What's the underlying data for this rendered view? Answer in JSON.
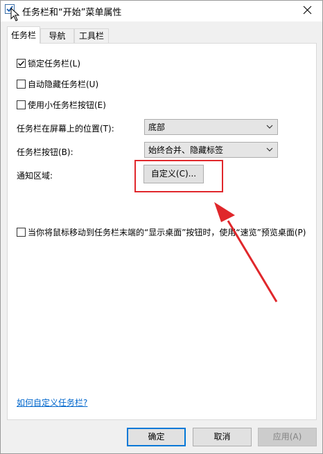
{
  "window": {
    "title": "任务栏和“开始”菜单属性"
  },
  "tabs": [
    {
      "label": "任务栏",
      "active": true
    },
    {
      "label": "导航",
      "active": false
    },
    {
      "label": "工具栏",
      "active": false
    }
  ],
  "options": {
    "lock_taskbar": {
      "label": "锁定任务栏(L)",
      "checked": true
    },
    "auto_hide": {
      "label": "自动隐藏任务栏(U)",
      "checked": false
    },
    "small_buttons": {
      "label": "使用小任务栏按钮(E)",
      "checked": false
    },
    "peek": {
      "label": "当你将鼠标移动到任务栏末端的“显示桌面”按钮时，使用“速览”预览桌面(P)",
      "checked": false
    }
  },
  "position": {
    "label": "任务栏在屏幕上的位置(T):",
    "value": "底部"
  },
  "buttons_combine": {
    "label": "任务栏按钮(B):",
    "value": "始终合并、隐藏标签"
  },
  "notification": {
    "label": "通知区域:",
    "customize_label": "自定义(C)..."
  },
  "help_link": "如何自定义任务栏?",
  "footer": {
    "ok": "确定",
    "cancel": "取消",
    "apply": "应用(A)"
  },
  "colors": {
    "annotation": "#e0272b",
    "accent": "#0078d7",
    "link": "#0066cc"
  }
}
